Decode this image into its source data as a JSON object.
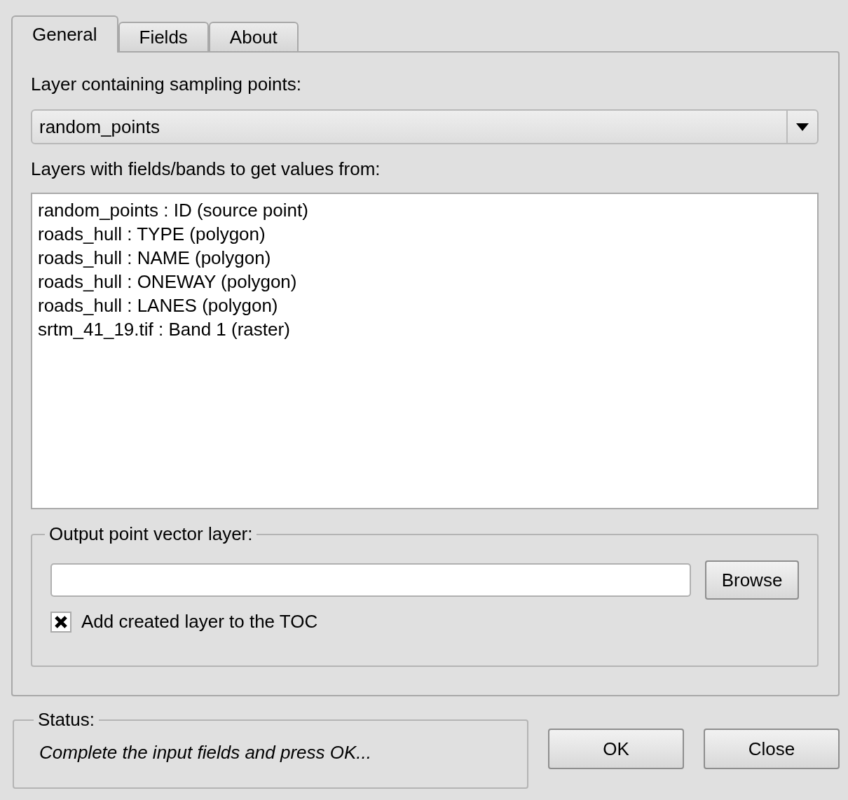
{
  "tabs": [
    {
      "label": "General",
      "selected": true
    },
    {
      "label": "Fields",
      "selected": false
    },
    {
      "label": "About",
      "selected": false
    }
  ],
  "sampling_layer": {
    "label": "Layer containing sampling points:",
    "value": "random_points"
  },
  "value_layers": {
    "label": "Layers with fields/bands to get values from:",
    "items": [
      {
        "text": "random_points : ID (source point)"
      },
      {
        "text": "roads_hull : TYPE (polygon)"
      },
      {
        "text": "roads_hull : NAME (polygon)"
      },
      {
        "text": "roads_hull : ONEWAY (polygon)"
      },
      {
        "text": "roads_hull : LANES (polygon)"
      },
      {
        "text": "srtm_41_19.tif : Band 1 (raster)"
      }
    ]
  },
  "output": {
    "title": "Output point vector layer:",
    "browse_button": "Browse",
    "add_to_toc": {
      "label": "Add created layer to the TOC",
      "checked": true
    }
  },
  "status": {
    "title": "Status:",
    "message": "Complete the input fields and press OK..."
  },
  "buttons": [
    "OK",
    "Close"
  ]
}
